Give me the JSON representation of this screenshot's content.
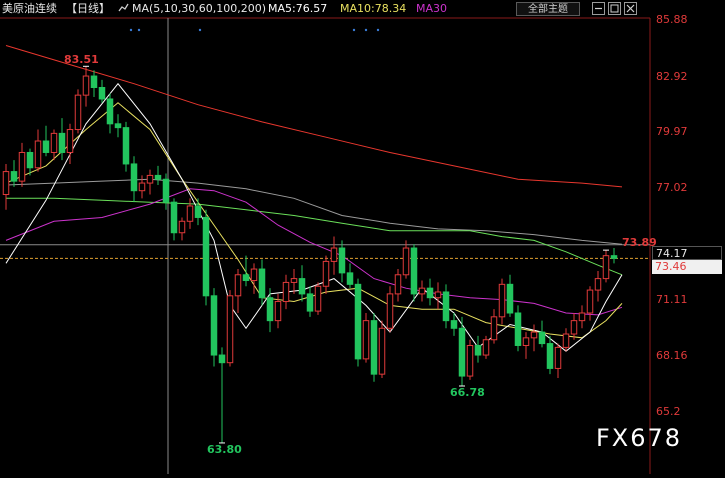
{
  "header": {
    "symbol": "美原油连续",
    "period": "【日线】",
    "ma_label": "MA(5,10,30,60,100,200)",
    "ma5": "MA5:76.57",
    "ma10": "MA10:78.34",
    "ma30": "MA30",
    "theme_button": "全部主题"
  },
  "colors": {
    "background": "#000000",
    "up": "#e03a3a",
    "down": "#22c55e",
    "ma5": "#ffffff",
    "ma10": "#e8e060",
    "ma30": "#cc33cc",
    "ma60": "#6be05a",
    "ma100": "#9a9a9a",
    "ma200": "#e8372e",
    "axis_text": "#e03a3a"
  },
  "toolbar_icons": [
    "chart-style-icon",
    "minimize-icon",
    "restore-icon",
    "close-icon"
  ],
  "chart_data": {
    "type": "candlestick",
    "y_axis_ticks": [
      85.88,
      82.92,
      79.97,
      77.02,
      74.17,
      71.11,
      68.16,
      65.2
    ],
    "price_tags": {
      "current": "73.46",
      "current_line": "74.17"
    },
    "annotations": {
      "high_1": "83.51",
      "low_1": "63.80",
      "low_2": "66.78",
      "recent_high": "73.89"
    },
    "candles": [
      [
        76.8,
        78.4,
        76.0,
        78.0
      ],
      [
        78.0,
        78.6,
        77.2,
        77.5
      ],
      [
        77.5,
        79.5,
        77.2,
        79.0
      ],
      [
        79.0,
        79.2,
        77.8,
        78.2
      ],
      [
        78.2,
        80.2,
        78.0,
        79.6
      ],
      [
        79.6,
        80.4,
        78.8,
        79.0
      ],
      [
        79.0,
        80.2,
        78.6,
        80.0
      ],
      [
        80.0,
        80.8,
        78.6,
        79.0
      ],
      [
        79.0,
        80.5,
        78.4,
        80.2
      ],
      [
        80.2,
        82.3,
        80.0,
        82.0
      ],
      [
        82.0,
        83.51,
        81.4,
        83.0
      ],
      [
        83.0,
        83.3,
        81.9,
        82.4
      ],
      [
        82.4,
        82.8,
        81.6,
        81.8
      ],
      [
        81.8,
        82.1,
        80.0,
        80.5
      ],
      [
        80.5,
        81.0,
        79.8,
        80.3
      ],
      [
        80.3,
        80.6,
        78.0,
        78.4
      ],
      [
        78.4,
        78.8,
        76.4,
        77.0
      ],
      [
        77.0,
        77.8,
        76.6,
        77.4
      ],
      [
        77.4,
        78.1,
        76.8,
        77.8
      ],
      [
        77.8,
        78.3,
        77.3,
        77.6
      ],
      [
        77.6,
        77.9,
        76.0,
        76.4
      ],
      [
        76.4,
        76.6,
        74.4,
        74.8
      ],
      [
        74.8,
        75.6,
        74.4,
        75.4
      ],
      [
        75.4,
        76.6,
        75.0,
        76.2
      ],
      [
        76.2,
        76.6,
        75.2,
        75.6
      ],
      [
        75.6,
        76.0,
        71.0,
        71.5
      ],
      [
        71.5,
        71.9,
        67.8,
        68.4
      ],
      [
        68.4,
        68.8,
        63.8,
        68.0
      ],
      [
        68.0,
        71.8,
        67.8,
        71.5
      ],
      [
        71.5,
        72.9,
        70.6,
        72.6
      ],
      [
        72.6,
        73.6,
        72.0,
        72.3
      ],
      [
        72.3,
        73.2,
        71.6,
        72.9
      ],
      [
        72.9,
        73.4,
        71.0,
        71.4
      ],
      [
        71.4,
        71.9,
        69.6,
        70.2
      ],
      [
        70.2,
        71.6,
        69.8,
        71.2
      ],
      [
        71.2,
        72.6,
        70.8,
        72.2
      ],
      [
        72.2,
        72.9,
        71.6,
        72.4
      ],
      [
        72.4,
        73.1,
        71.2,
        71.6
      ],
      [
        71.6,
        72.0,
        70.4,
        70.7
      ],
      [
        70.7,
        72.2,
        70.5,
        72.0
      ],
      [
        72.0,
        73.6,
        71.6,
        73.3
      ],
      [
        73.3,
        74.6,
        72.6,
        74.0
      ],
      [
        74.0,
        74.4,
        72.2,
        72.7
      ],
      [
        72.7,
        73.2,
        71.9,
        72.1
      ],
      [
        72.1,
        72.4,
        67.8,
        68.2
      ],
      [
        68.2,
        70.6,
        68.0,
        70.2
      ],
      [
        70.2,
        70.6,
        67.0,
        67.4
      ],
      [
        67.4,
        70.2,
        67.2,
        69.8
      ],
      [
        69.8,
        72.0,
        69.6,
        71.6
      ],
      [
        71.6,
        72.9,
        71.2,
        72.6
      ],
      [
        72.6,
        74.4,
        72.4,
        74.0
      ],
      [
        74.0,
        74.2,
        71.2,
        71.6
      ],
      [
        71.6,
        72.3,
        71.2,
        71.9
      ],
      [
        71.9,
        72.4,
        71.0,
        71.4
      ],
      [
        71.4,
        72.2,
        70.8,
        71.7
      ],
      [
        71.7,
        72.1,
        69.8,
        70.2
      ],
      [
        70.2,
        70.6,
        69.4,
        69.8
      ],
      [
        69.8,
        70.4,
        66.78,
        67.3
      ],
      [
        67.3,
        69.2,
        67.1,
        68.9
      ],
      [
        68.9,
        69.4,
        68.0,
        68.4
      ],
      [
        68.4,
        69.4,
        68.2,
        69.2
      ],
      [
        69.2,
        70.8,
        69.0,
        70.4
      ],
      [
        70.4,
        72.4,
        70.0,
        72.1
      ],
      [
        72.1,
        72.6,
        70.4,
        70.6
      ],
      [
        70.6,
        71.0,
        68.6,
        68.9
      ],
      [
        68.9,
        69.6,
        68.2,
        69.3
      ],
      [
        69.3,
        70.0,
        68.6,
        69.6
      ],
      [
        69.6,
        70.2,
        68.8,
        69.0
      ],
      [
        69.0,
        69.4,
        67.4,
        67.7
      ],
      [
        67.7,
        69.0,
        67.2,
        68.8
      ],
      [
        68.8,
        69.8,
        68.6,
        69.5
      ],
      [
        69.5,
        70.6,
        69.2,
        70.2
      ],
      [
        70.2,
        71.0,
        69.8,
        70.6
      ],
      [
        70.6,
        72.0,
        70.2,
        71.8
      ],
      [
        71.8,
        72.8,
        71.2,
        72.4
      ],
      [
        72.4,
        73.89,
        72.2,
        73.6
      ],
      [
        73.6,
        74.0,
        73.2,
        73.46
      ]
    ],
    "ma_lines": {
      "ma5": [
        [
          0,
          73.2
        ],
        [
          5,
          76.5
        ],
        [
          10,
          80.5
        ],
        [
          14,
          82.6
        ],
        [
          18,
          80.5
        ],
        [
          22,
          77.6
        ],
        [
          26,
          74.4
        ],
        [
          28,
          71.0
        ],
        [
          30,
          69.8
        ],
        [
          33,
          71.6
        ],
        [
          37,
          71.8
        ],
        [
          41,
          72.4
        ],
        [
          45,
          71.0
        ],
        [
          48,
          69.6
        ],
        [
          52,
          71.9
        ],
        [
          56,
          70.6
        ],
        [
          59,
          68.8
        ],
        [
          63,
          70.0
        ],
        [
          67,
          69.6
        ],
        [
          70,
          68.6
        ],
        [
          73,
          69.6
        ],
        [
          75,
          71.2
        ],
        [
          77,
          72.6
        ]
      ],
      "ma10": [
        [
          0,
          77.4
        ],
        [
          5,
          78.3
        ],
        [
          10,
          80.2
        ],
        [
          14,
          81.6
        ],
        [
          18,
          80.2
        ],
        [
          22,
          77.6
        ],
        [
          26,
          75.2
        ],
        [
          29,
          73.4
        ],
        [
          32,
          71.4
        ],
        [
          36,
          71.2
        ],
        [
          40,
          71.7
        ],
        [
          44,
          71.9
        ],
        [
          48,
          71.0
        ],
        [
          52,
          70.8
        ],
        [
          56,
          70.8
        ],
        [
          60,
          70.1
        ],
        [
          64,
          69.8
        ],
        [
          68,
          69.5
        ],
        [
          72,
          69.3
        ],
        [
          75,
          70.2
        ],
        [
          77,
          71.1
        ]
      ],
      "ma30": [
        [
          0,
          74.4
        ],
        [
          6,
          75.4
        ],
        [
          12,
          75.6
        ],
        [
          18,
          76.3
        ],
        [
          23,
          77.1
        ],
        [
          26,
          77.0
        ],
        [
          30,
          76.4
        ],
        [
          34,
          75.2
        ],
        [
          38,
          74.3
        ],
        [
          42,
          73.6
        ],
        [
          46,
          72.4
        ],
        [
          50,
          71.9
        ],
        [
          54,
          71.6
        ],
        [
          58,
          71.4
        ],
        [
          62,
          71.3
        ],
        [
          66,
          71.1
        ],
        [
          70,
          70.6
        ],
        [
          74,
          70.5
        ],
        [
          77,
          70.9
        ]
      ],
      "ma60": [
        [
          0,
          76.6
        ],
        [
          6,
          76.6
        ],
        [
          12,
          76.5
        ],
        [
          18,
          76.4
        ],
        [
          24,
          76.3
        ],
        [
          30,
          76.0
        ],
        [
          36,
          75.7
        ],
        [
          42,
          75.3
        ],
        [
          48,
          74.9
        ],
        [
          54,
          74.9
        ],
        [
          58,
          74.9
        ],
        [
          62,
          74.6
        ],
        [
          66,
          74.4
        ],
        [
          70,
          73.8
        ],
        [
          74,
          73.1
        ],
        [
          77,
          72.6
        ]
      ],
      "ma100": [
        [
          0,
          77.3
        ],
        [
          6,
          77.4
        ],
        [
          12,
          77.5
        ],
        [
          18,
          77.6
        ],
        [
          24,
          77.4
        ],
        [
          30,
          77.1
        ],
        [
          36,
          76.6
        ],
        [
          42,
          75.7
        ],
        [
          48,
          75.3
        ],
        [
          54,
          75.0
        ],
        [
          60,
          74.9
        ],
        [
          66,
          74.7
        ],
        [
          72,
          74.4
        ],
        [
          77,
          74.2
        ]
      ],
      "ma200": [
        [
          0,
          84.6
        ],
        [
          8,
          83.6
        ],
        [
          16,
          82.6
        ],
        [
          24,
          81.5
        ],
        [
          32,
          80.6
        ],
        [
          40,
          79.8
        ],
        [
          48,
          79.0
        ],
        [
          56,
          78.3
        ],
        [
          64,
          77.6
        ],
        [
          72,
          77.4
        ],
        [
          77,
          77.2
        ]
      ]
    }
  }
}
